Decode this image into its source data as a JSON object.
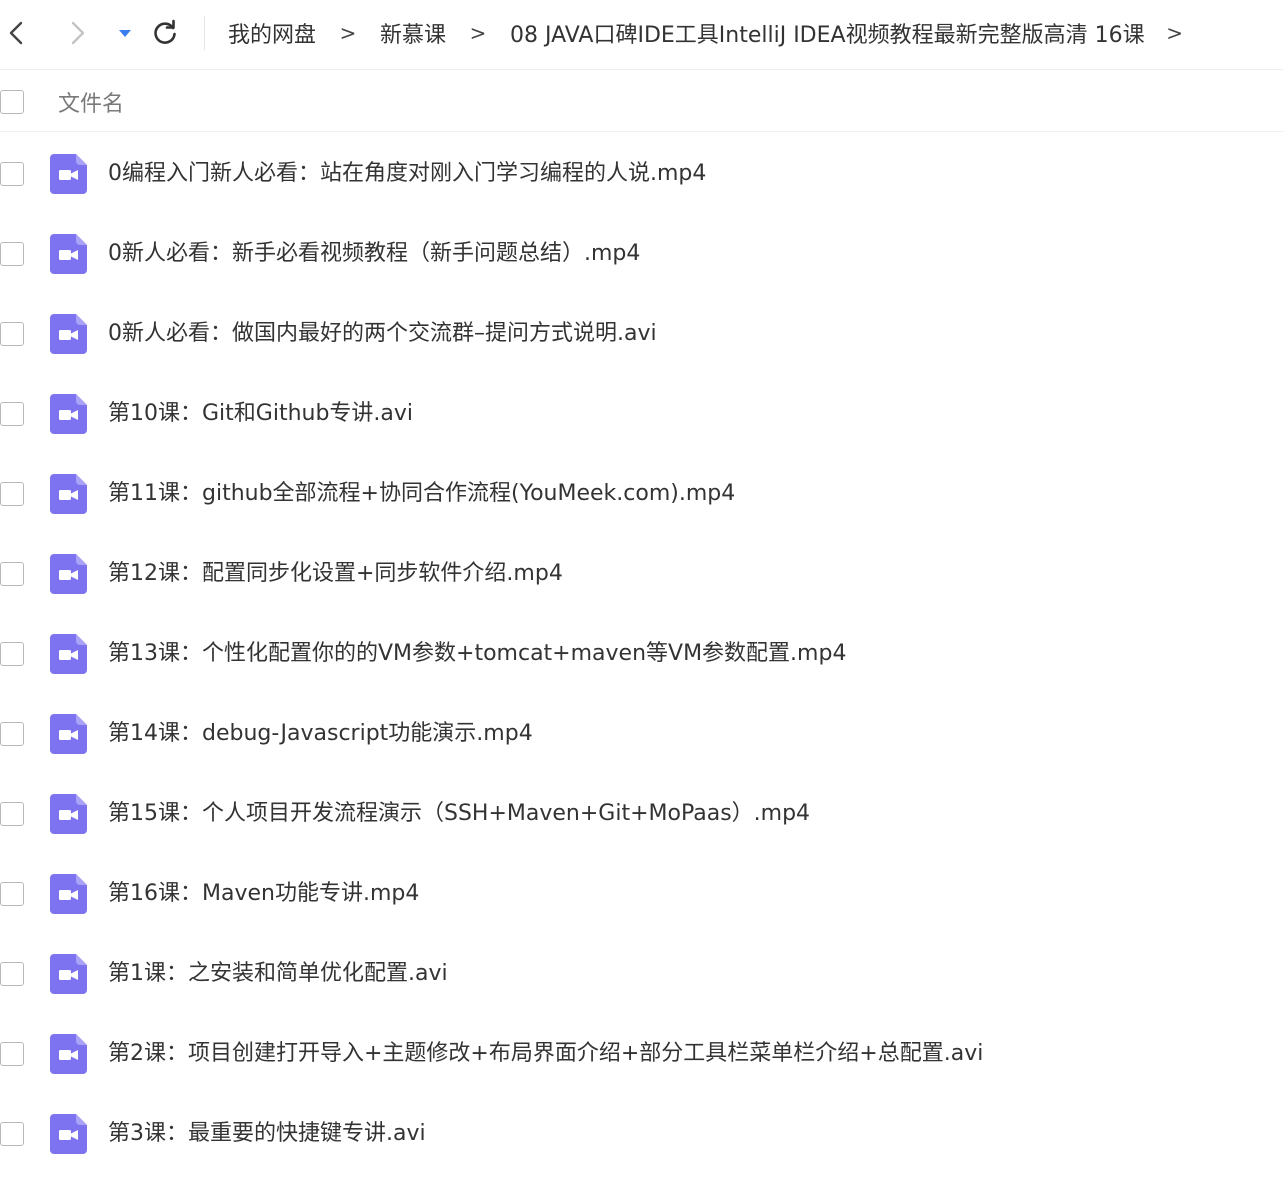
{
  "breadcrumb": {
    "items": [
      "我的网盘",
      "新慕课",
      "08 JAVA口碑IDE工具IntelliJ IDEA视频教程最新完整版高清 16课"
    ],
    "separator": ">"
  },
  "header": {
    "column_label": "文件名"
  },
  "files": [
    "0编程入门新人必看：站在角度对刚入门学习编程的人说.mp4",
    "0新人必看：新手必看视频教程（新手问题总结）.mp4",
    "0新人必看：做国内最好的两个交流群–提问方式说明.avi",
    "第10课：Git和Github专讲.avi",
    "第11课：github全部流程+协同合作流程(YouMeek.com).mp4",
    "第12课：配置同步化设置+同步软件介绍.mp4",
    "第13课：个性化配置你的的VM参数+tomcat+maven等VM参数配置.mp4",
    "第14课：debug-Javascript功能演示.mp4",
    "第15课：个人项目开发流程演示（SSH+Maven+Git+MoPaas）.mp4",
    "第16课：Maven功能专讲.mp4",
    "第1课：之安装和简单优化配置.avi",
    "第2课：项目创建打开导入+主题修改+布局界面介绍+部分工具栏菜单栏介绍+总配置.avi",
    "第3课：最重要的快捷键专讲.avi"
  ],
  "icons": {
    "file_type": "video-file-icon",
    "accent_color": "#7d73f0"
  }
}
